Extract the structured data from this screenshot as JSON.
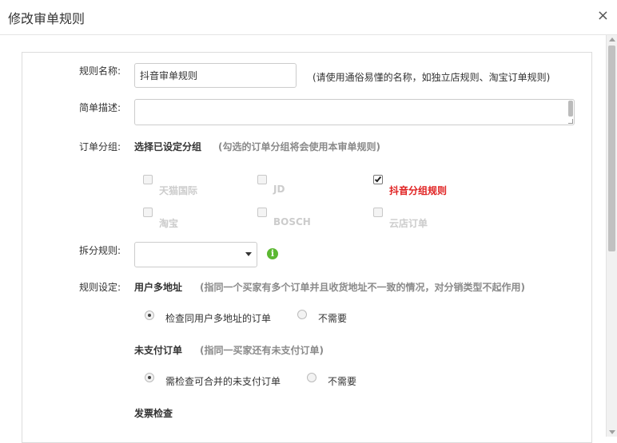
{
  "dialog": {
    "title": "修改审单规则",
    "close_symbol": "×"
  },
  "form": {
    "rule_name": {
      "label": "规则名称:",
      "value": "抖音审单规则",
      "hint": "(请使用通俗易懂的名称，如独立店规则、淘宝订单规则)"
    },
    "description": {
      "label": "简单描述:",
      "value": ""
    },
    "order_group": {
      "label": "订单分组:",
      "title": "选择已设定分组",
      "hint": "(勾选的订单分组将会使用本审单规则)",
      "groups": [
        {
          "label": "天猫国际",
          "checked": false
        },
        {
          "label": "JD",
          "checked": false
        },
        {
          "label": "抖音分组规则",
          "checked": true
        },
        {
          "label": "淘宝",
          "checked": false
        },
        {
          "label": "BOSCH",
          "checked": false
        },
        {
          "label": "云店订单",
          "checked": false
        }
      ]
    },
    "split_rule": {
      "label": "拆分规则:",
      "selected": "",
      "info_symbol": "i"
    },
    "rule_settings": {
      "label": "规则设定:",
      "multi_address": {
        "title": "用户多地址",
        "hint": "(指同一个买家有多个订单并且收货地址不一致的情况，对分销类型不起作用)",
        "options": [
          {
            "label": "检查同用户多地址的订单",
            "selected": true
          },
          {
            "label": "不需要",
            "selected": false
          }
        ]
      },
      "unpaid": {
        "title": "未支付订单",
        "hint": "(指同一买家还有未支付订单)",
        "options": [
          {
            "label": "需检查可合并的未支付订单",
            "selected": true
          },
          {
            "label": "不需要",
            "selected": false
          }
        ]
      },
      "invoice": {
        "title": "发票检查"
      }
    }
  }
}
